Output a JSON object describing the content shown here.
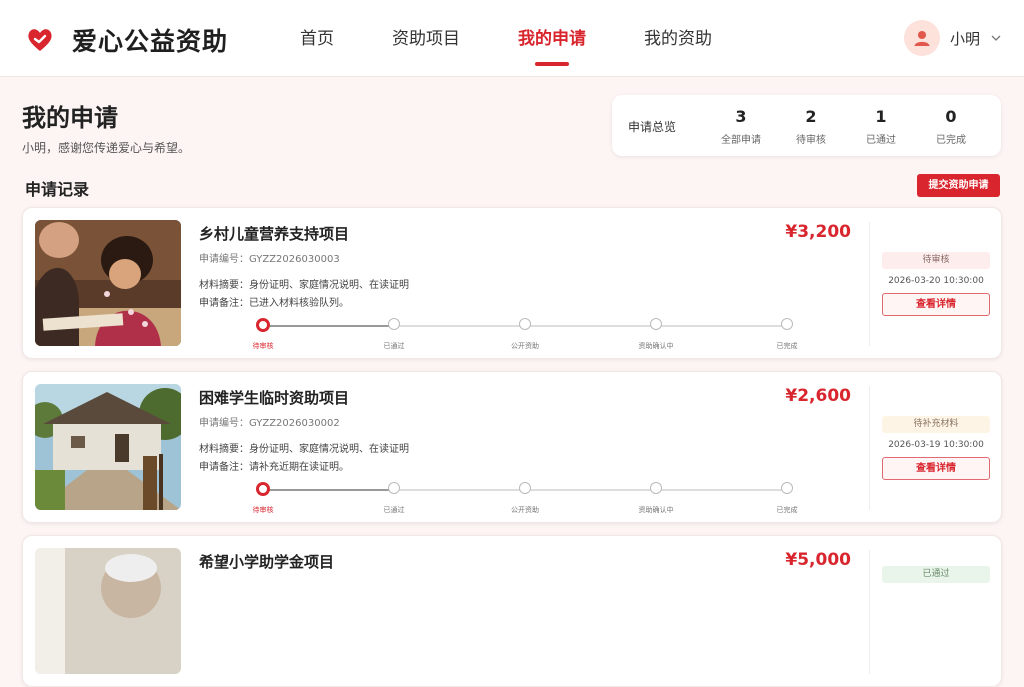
{
  "app": {
    "name": "爱心公益资助"
  },
  "nav": {
    "items": [
      {
        "label": "首页"
      },
      {
        "label": "资助项目"
      },
      {
        "label": "我的申请"
      },
      {
        "label": "我的资助"
      }
    ],
    "active_index": 2
  },
  "user": {
    "name": "小明"
  },
  "page": {
    "title": "我的申请",
    "subtitle": "小明，感谢您传递爱心与希望。"
  },
  "summary": {
    "label": "申请总览",
    "stats": [
      {
        "value": "3",
        "label": "全部申请"
      },
      {
        "value": "2",
        "label": "待审核"
      },
      {
        "value": "1",
        "label": "已通过"
      },
      {
        "value": "0",
        "label": "已完成"
      }
    ]
  },
  "records": {
    "title": "申请记录",
    "submit_label": "提交资助申请"
  },
  "steps": [
    "待审核",
    "已通过",
    "公开资助",
    "资助确认中",
    "已完成"
  ],
  "applications": [
    {
      "title": "乡村儿童营养支持项目",
      "code": "申请编号：GYZZ2026030003",
      "materials": "材料摘要：身份证明、家庭情况说明、在读证明",
      "note": "申请备注：已进入材料核验队列。",
      "amount": "¥3,200",
      "status": "待审核",
      "date": "2026-03-20 10:30:00",
      "detail_label": "查看详情",
      "current_step": 0
    },
    {
      "title": "困难学生临时资助项目",
      "code": "申请编号：GYZZ2026030002",
      "materials": "材料摘要：身份证明、家庭情况说明、在读证明",
      "note": "申请备注：请补充近期在读证明。",
      "amount": "¥2,600",
      "status": "待补充材料",
      "date": "2026-03-19 10:30:00",
      "detail_label": "查看详情",
      "current_step": 0
    },
    {
      "title": "希望小学助学金项目",
      "amount": "¥5,000",
      "status": "已通过"
    }
  ],
  "colors": {
    "accent": "#d9262e",
    "background": "#fdf5f3"
  }
}
